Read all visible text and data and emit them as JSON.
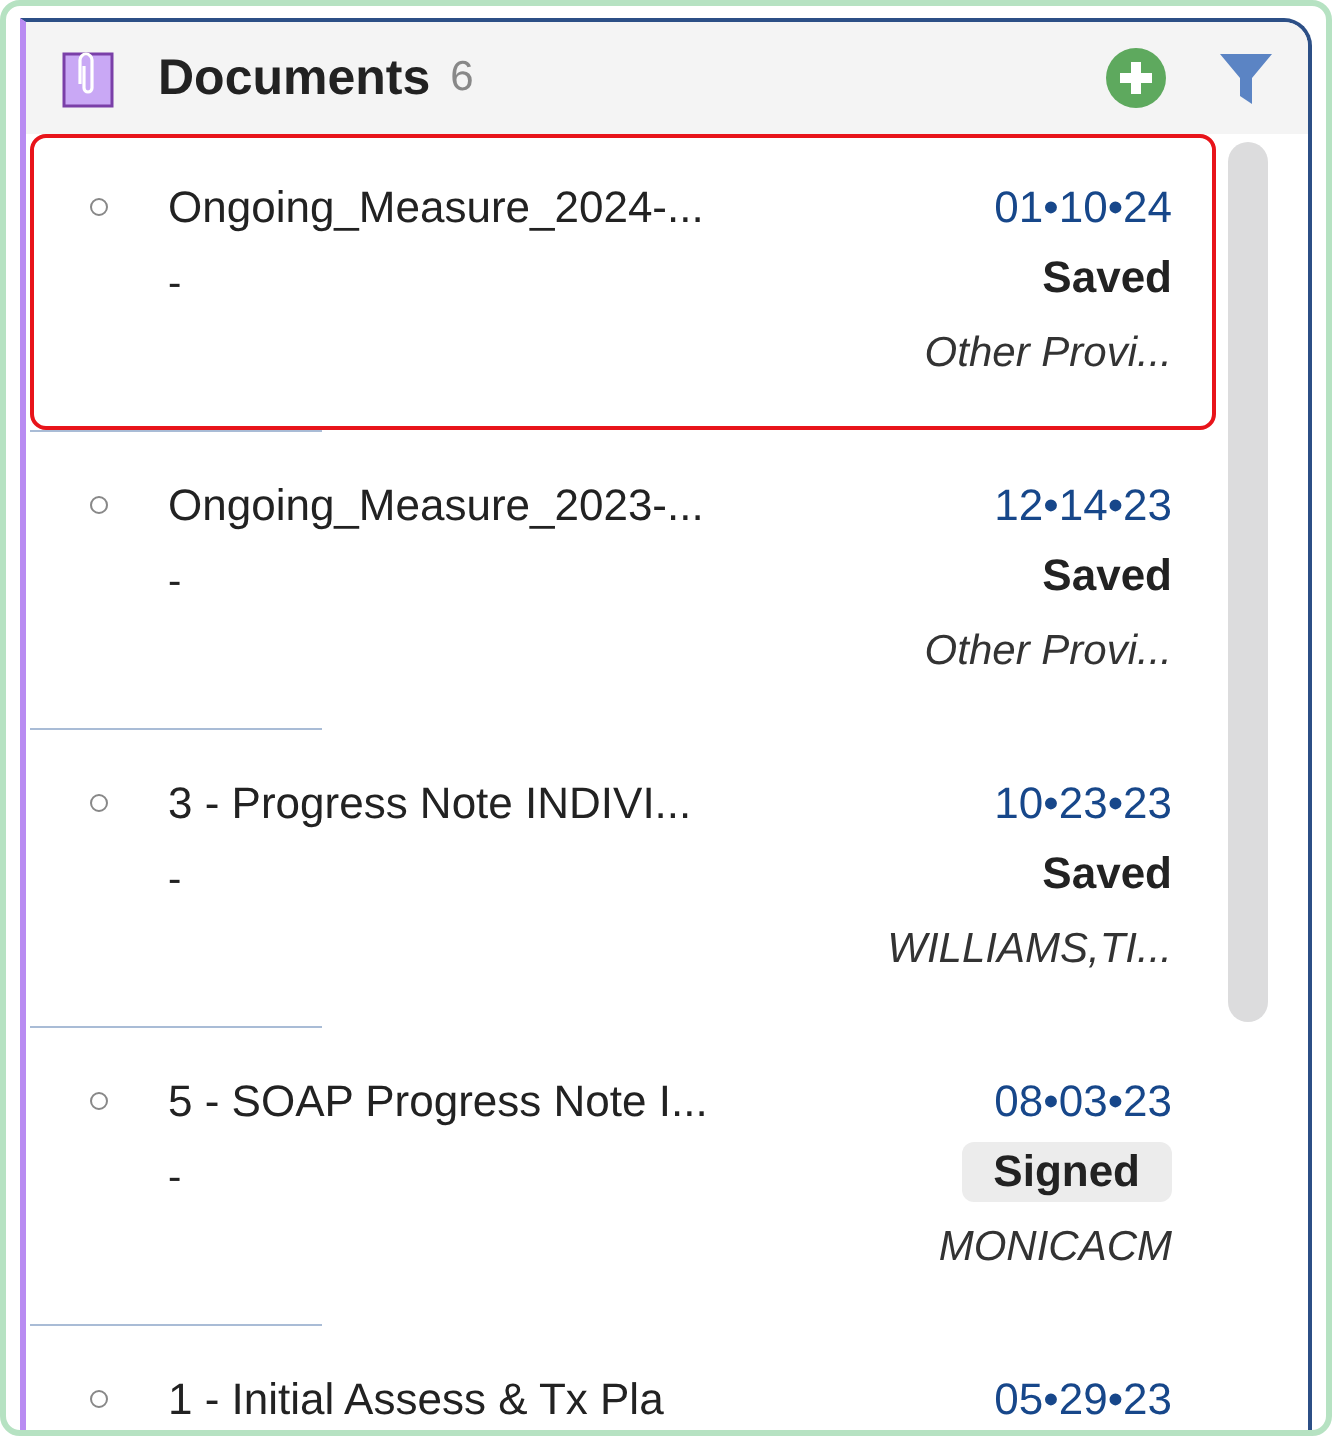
{
  "panel": {
    "title": "Documents",
    "count": "6"
  },
  "documents": [
    {
      "title": "Ongoing_Measure_2024-...",
      "subtitle": "-",
      "date": "01•10•24",
      "status": "Saved",
      "status_highlighted": false,
      "author": "Other Provi...",
      "selected": true
    },
    {
      "title": "Ongoing_Measure_2023-...",
      "subtitle": "-",
      "date": "12•14•23",
      "status": "Saved",
      "status_highlighted": false,
      "author": "Other Provi...",
      "selected": false
    },
    {
      "title": "3 - Progress Note INDIVI...",
      "subtitle": "-",
      "date": "10•23•23",
      "status": "Saved",
      "status_highlighted": false,
      "author": "WILLIAMS,TI...",
      "selected": false
    },
    {
      "title": "5 - SOAP Progress Note I...",
      "subtitle": "-",
      "date": "08•03•23",
      "status": "Signed",
      "status_highlighted": true,
      "author": "MONICACM",
      "selected": false
    },
    {
      "title": "1 - Initial Assess & Tx Pla",
      "date": "05•29•23",
      "selected": false
    }
  ]
}
